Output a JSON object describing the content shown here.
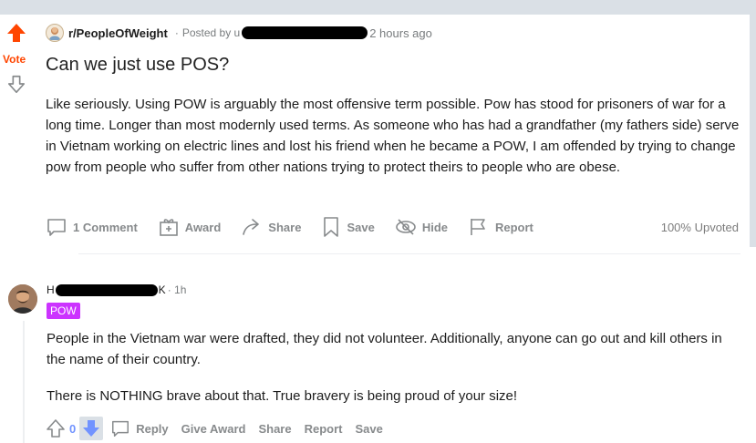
{
  "vote": {
    "label": "Vote"
  },
  "post": {
    "subreddit": "r/PeopleOfWeight",
    "posted_by_prefix": "Posted by u",
    "time": "2 hours ago",
    "title": "Can we just use POS?",
    "body": "Like seriously. Using POW is arguably the most offensive term possible. Pow has stood for prisoners of war for a long time. Longer than most modernly used terms. As someone who has had a grandfather (my fathers side) serve in Vietnam working on electric lines and lost his friend when he became a POW, I am offended by trying to change pow from people who suffer from other nations trying to protect theirs to people who are obese.",
    "actions": {
      "comments": "1 Comment",
      "award": "Award",
      "share": "Share",
      "save": "Save",
      "hide": "Hide",
      "report": "Report"
    },
    "upvoted": "100% Upvoted"
  },
  "comment": {
    "author_start": "H",
    "author_end": "K",
    "time": "· 1h",
    "flair": "POW",
    "paragraphs": [
      "People in the Vietnam war were drafted, they did not volunteer. Additionally, anyone can go out and kill others in the name of their country.",
      "There is NOTHING brave about that. True bravery is being proud of your size!"
    ],
    "score": "0",
    "actions": {
      "reply": "Reply",
      "give_award": "Give Award",
      "share": "Share",
      "report": "Report",
      "save": "Save"
    }
  },
  "colors": {
    "upvote": "#ff4500",
    "downvote_active": "#7193ff",
    "flair_bg": "#cc33ff",
    "meta_gray": "#878a8c"
  },
  "icons": [
    "upvote-arrow-icon",
    "downvote-arrow-icon",
    "subreddit-avatar-icon",
    "comment-icon",
    "award-icon",
    "share-icon",
    "save-icon",
    "hide-icon",
    "report-icon",
    "user-avatar-icon",
    "reply-icon"
  ]
}
